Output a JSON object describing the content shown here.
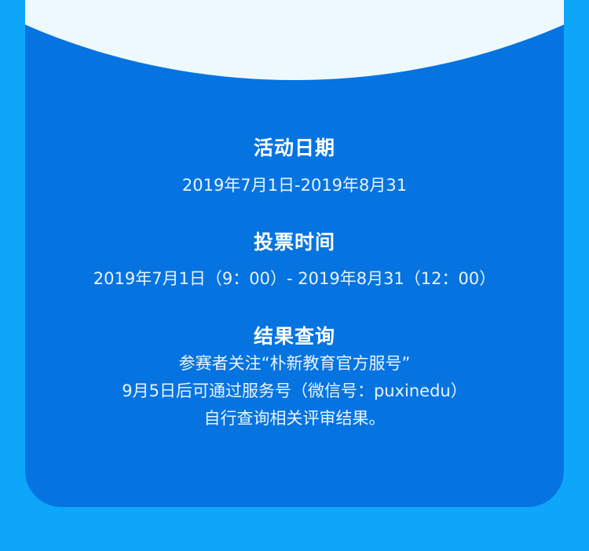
{
  "activity": {
    "title": "活动日期",
    "text": "2019年7月1日-2019年8月31"
  },
  "voting": {
    "title": "投票时间",
    "text": "2019年7月1日（9：00）- 2019年8月31（12：00）"
  },
  "results": {
    "title": "结果查询",
    "lines": [
      "参赛者关注“朴新教育官方服号”",
      "9月5日后可通过服务号（微信号：puxinedu）",
      "自行查询相关评审结果。"
    ]
  },
  "colors": {
    "page_background": "#0DA6F9",
    "card_background": "#0574E1",
    "arc_background": "#EEF9FE",
    "text": "#FFFFFF"
  }
}
